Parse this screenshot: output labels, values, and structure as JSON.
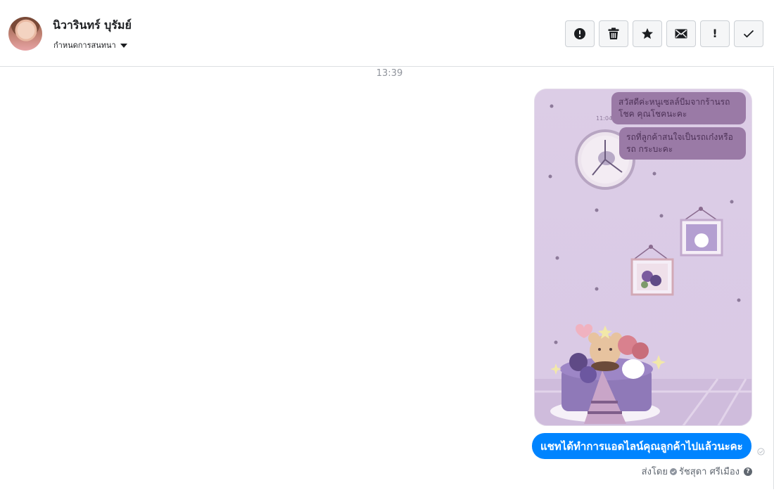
{
  "header": {
    "contact_name": "นิวารินทร์ บุรัมย์",
    "conversation_menu_label": "กำหนดการสนทนา",
    "toolbar": [
      {
        "name": "report-spam-button",
        "icon": "alert-circle-icon"
      },
      {
        "name": "delete-button",
        "icon": "trash-icon"
      },
      {
        "name": "star-button",
        "icon": "star-icon"
      },
      {
        "name": "mark-unread-button",
        "icon": "envelope-icon"
      },
      {
        "name": "follow-up-button",
        "icon": "exclamation-icon",
        "label": "!"
      },
      {
        "name": "mark-done-button",
        "icon": "check-icon"
      }
    ]
  },
  "conversation": {
    "timestamp": "13:39",
    "image_message": {
      "bubbles": [
        "สวัสดีค่ะหนูเซลล์บีมจากร้านรถโชค คุณโชคนะคะ",
        "รถที่ลูกค้าสนใจเป็นรถเก๋งหรือรถ กระบะคะ"
      ],
      "time_label": "11:04",
      "accent_colors": [
        "#dccde6",
        "#9a7aa6",
        "#7b5a9e"
      ]
    },
    "text_message": "แชทได้ทำการแอดไลน์คุณลูกค้าไปแล้วนะคะ",
    "sent_by_label": "ส่งโดย",
    "sender_name": "รัชสุดา ศรีเมือง",
    "help_label": "?"
  },
  "colors": {
    "message_blue": "#0084ff",
    "border": "#dddfe2",
    "muted_text": "#90949c"
  }
}
